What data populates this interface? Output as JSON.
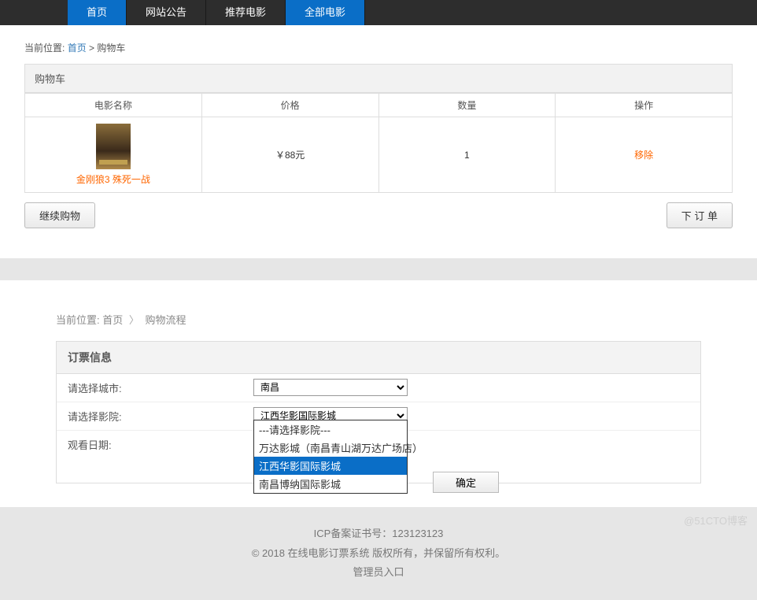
{
  "nav": {
    "items": [
      {
        "label": "首页",
        "active": true
      },
      {
        "label": "网站公告",
        "active": false
      },
      {
        "label": "推荐电影",
        "active": false
      },
      {
        "label": "全部电影",
        "active": true
      }
    ]
  },
  "cart": {
    "breadcrumb_prefix": "当前位置:",
    "breadcrumb_home": "首页",
    "breadcrumb_sep": " > ",
    "breadcrumb_current": "购物车",
    "panel_title": "购物车",
    "headers": {
      "name": "电影名称",
      "price": "价格",
      "qty": "数量",
      "action": "操作"
    },
    "item": {
      "movie_name": "金刚狼3 殊死一战",
      "price": "￥88元",
      "qty": "1",
      "remove": "移除"
    },
    "continue_btn": "继续购物",
    "order_btn": "下 订 单"
  },
  "flow": {
    "breadcrumb_prefix": "当前位置:",
    "breadcrumb_home": "首页",
    "breadcrumb_current": "购物流程",
    "panel_title": "订票信息",
    "city_label": "请选择城市:",
    "city_value": "南昌",
    "cinema_label": "请选择影院:",
    "cinema_value": "江西华影国际影城",
    "date_label": "观看日期:",
    "confirm_btn": "确定",
    "cinema_options": [
      {
        "label": "---请选择影院---",
        "highlight": false
      },
      {
        "label": "万达影城（南昌青山湖万达广场店）",
        "highlight": false
      },
      {
        "label": "江西华影国际影城",
        "highlight": true
      },
      {
        "label": "南昌博纳国际影城",
        "highlight": false
      }
    ]
  },
  "footer": {
    "icp": "ICP备案证书号：123123123",
    "copyright": "© 2018 在线电影订票系统 版权所有，并保留所有权利。",
    "admin": "管理员入口"
  },
  "watermark": {
    "bottom": "@51CTO博客"
  }
}
